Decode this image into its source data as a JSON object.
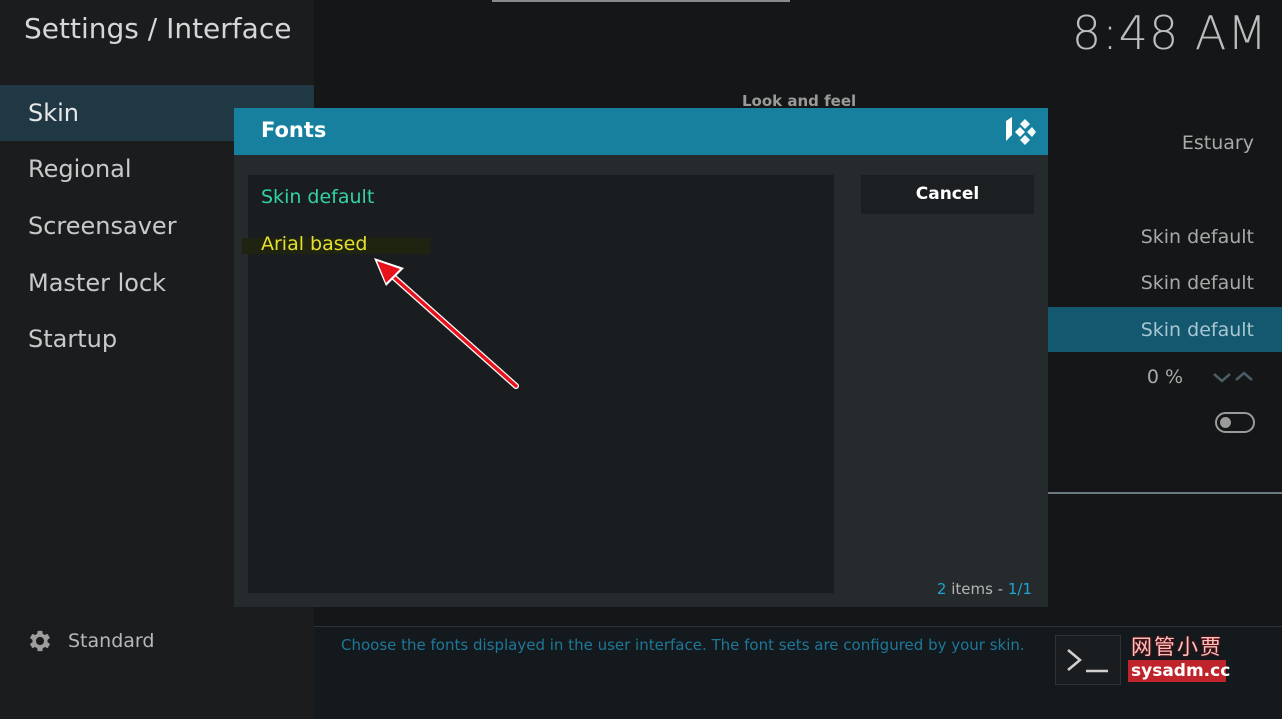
{
  "header": {
    "title": "Settings / Interface",
    "clock": "8:48 AM"
  },
  "sidebar": {
    "items": [
      {
        "label": "Skin"
      },
      {
        "label": "Regional"
      },
      {
        "label": "Screensaver"
      },
      {
        "label": "Master lock"
      },
      {
        "label": "Startup"
      }
    ],
    "footer_label": "Standard"
  },
  "main": {
    "section_label": "Look and feel",
    "values": [
      "Estuary",
      "Skin default",
      "Skin default",
      "Skin default",
      "0 %"
    ],
    "help_text": "Choose the fonts displayed in the user interface. The font sets are configured by your skin."
  },
  "dialog": {
    "title": "Fonts",
    "items": [
      {
        "label": "Skin default"
      },
      {
        "label": "Arial based"
      }
    ],
    "cancel_label": "Cancel",
    "count": {
      "n": "2",
      "label": " items - ",
      "page": "1/1"
    }
  },
  "watermark": {
    "cn": "网管小贾",
    "en": "sysadm.cc"
  },
  "colors": {
    "accent": "#17809f",
    "highlight": "#14586f",
    "selected_text": "#e7df2e",
    "item_text": "#33d3a1",
    "annotation_arrow": "#e8121c"
  }
}
